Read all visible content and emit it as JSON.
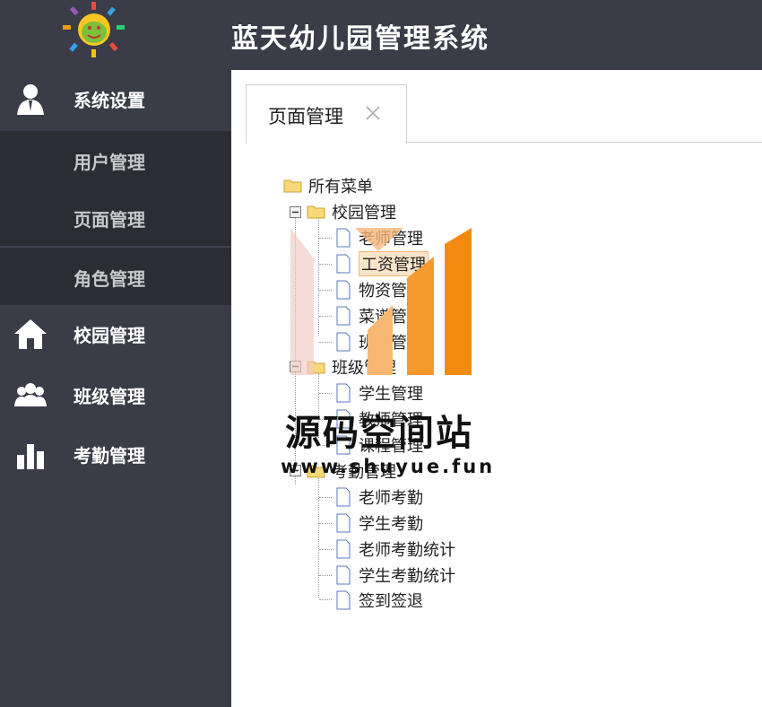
{
  "app": {
    "title": "蓝天幼儿园管理系统"
  },
  "sidebar": {
    "groups": [
      {
        "label": "系统设置",
        "icon": "user-icon"
      },
      {
        "label": "校园管理",
        "icon": "home-icon"
      },
      {
        "label": "班级管理",
        "icon": "group-icon"
      },
      {
        "label": "考勤管理",
        "icon": "bar-chart-icon"
      }
    ],
    "sub_items": [
      {
        "label": "用户管理"
      },
      {
        "label": "页面管理"
      },
      {
        "label": "角色管理"
      }
    ]
  },
  "tab": {
    "label": "页面管理"
  },
  "tree": {
    "root": "所有菜单",
    "nodes": [
      "校园管理",
      "老师管理",
      "工资管理",
      "物资管理",
      "菜谱管理",
      "班级管理",
      "班级管理",
      "学生管理",
      "教师管理",
      "课程管理",
      "考勤管理",
      "老师考勤",
      "学生考勤",
      "老师考勤统计",
      "学生考勤统计",
      "签到签退"
    ]
  },
  "watermark": {
    "title": "源码空间站",
    "url": "www.shuyue.fun"
  },
  "colors": {
    "sidebar": "#3a3c48",
    "sub_item": "#2b2c34",
    "selected_bg": "#fbe5c8",
    "selected_border": "#f0b878"
  }
}
